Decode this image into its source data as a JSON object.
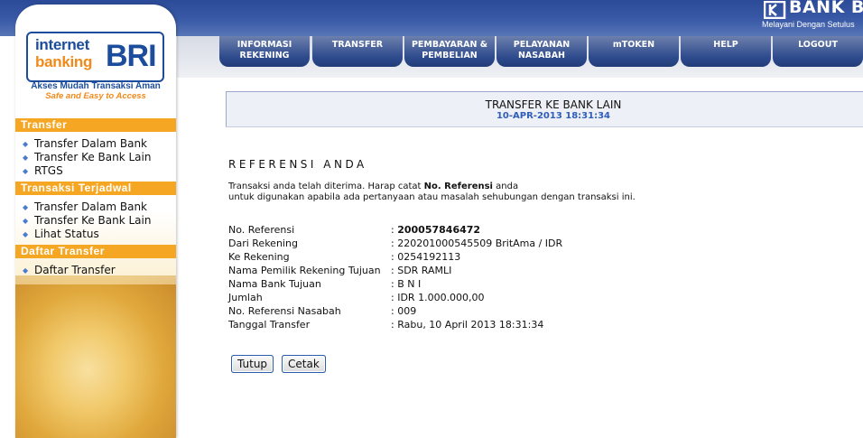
{
  "brand": {
    "bank_name": "BANK B",
    "slogan": "Melayani Dengan Setulus"
  },
  "sidebar": {
    "logo_line1": "internet",
    "logo_line2": "banking",
    "logo_bri": "BRI",
    "tagline1": "Akses Mudah Transaksi Aman",
    "tagline2": "Safe and Easy to Access",
    "sections": [
      {
        "title": "Transfer",
        "items": [
          "Transfer Dalam Bank",
          "Transfer Ke Bank Lain",
          "RTGS"
        ]
      },
      {
        "title": "Transaksi Terjadwal",
        "items": [
          "Transfer Dalam Bank",
          "Transfer Ke Bank Lain",
          "Lihat Status"
        ]
      },
      {
        "title": "Daftar Transfer",
        "items": [
          "Daftar Transfer"
        ]
      }
    ]
  },
  "nav": {
    "items": [
      {
        "line1": "INFORMASI",
        "line2": "REKENING"
      },
      {
        "line1": "TRANSFER",
        "line2": ""
      },
      {
        "line1": "PEMBAYARAN &",
        "line2": "PEMBELIAN"
      },
      {
        "line1": "PELAYANAN",
        "line2": "NASABAH"
      },
      {
        "line1": "mTOKEN",
        "line2": ""
      },
      {
        "line1": "HELP",
        "line2": ""
      },
      {
        "line1": "LOGOUT",
        "line2": ""
      }
    ]
  },
  "page": {
    "title": "TRANSFER KE BANK LAIN",
    "datetime": "10-APR-2013 18:31:34",
    "ref_heading": "REFERENSI ANDA",
    "info_pre": "Transaksi anda telah diterima. Harap catat ",
    "info_bold": "No. Referensi",
    "info_post": " anda",
    "info_line2": "untuk digunakan apabila ada pertanyaan atau masalah sehubungan dengan transaksi ini."
  },
  "details": [
    {
      "label": "No. Referensi",
      "value": "200057846472"
    },
    {
      "label": "Dari Rekening",
      "value": "220201000545509 BritAma / IDR"
    },
    {
      "label": "Ke Rekening",
      "value": "0254192113"
    },
    {
      "label": "Nama Pemilik Rekening Tujuan",
      "value": "SDR RAMLI"
    },
    {
      "label": "Nama Bank Tujuan",
      "value": "B N I"
    },
    {
      "label": "Jumlah",
      "value": "IDR 1.000.000,00"
    },
    {
      "label": "No. Referensi Nasabah",
      "value": "009"
    },
    {
      "label": "Tanggal Transfer",
      "value": "Rabu, 10 April 2013 18:31:34"
    }
  ],
  "separator": ":",
  "buttons": {
    "close": "Tutup",
    "print": "Cetak"
  }
}
